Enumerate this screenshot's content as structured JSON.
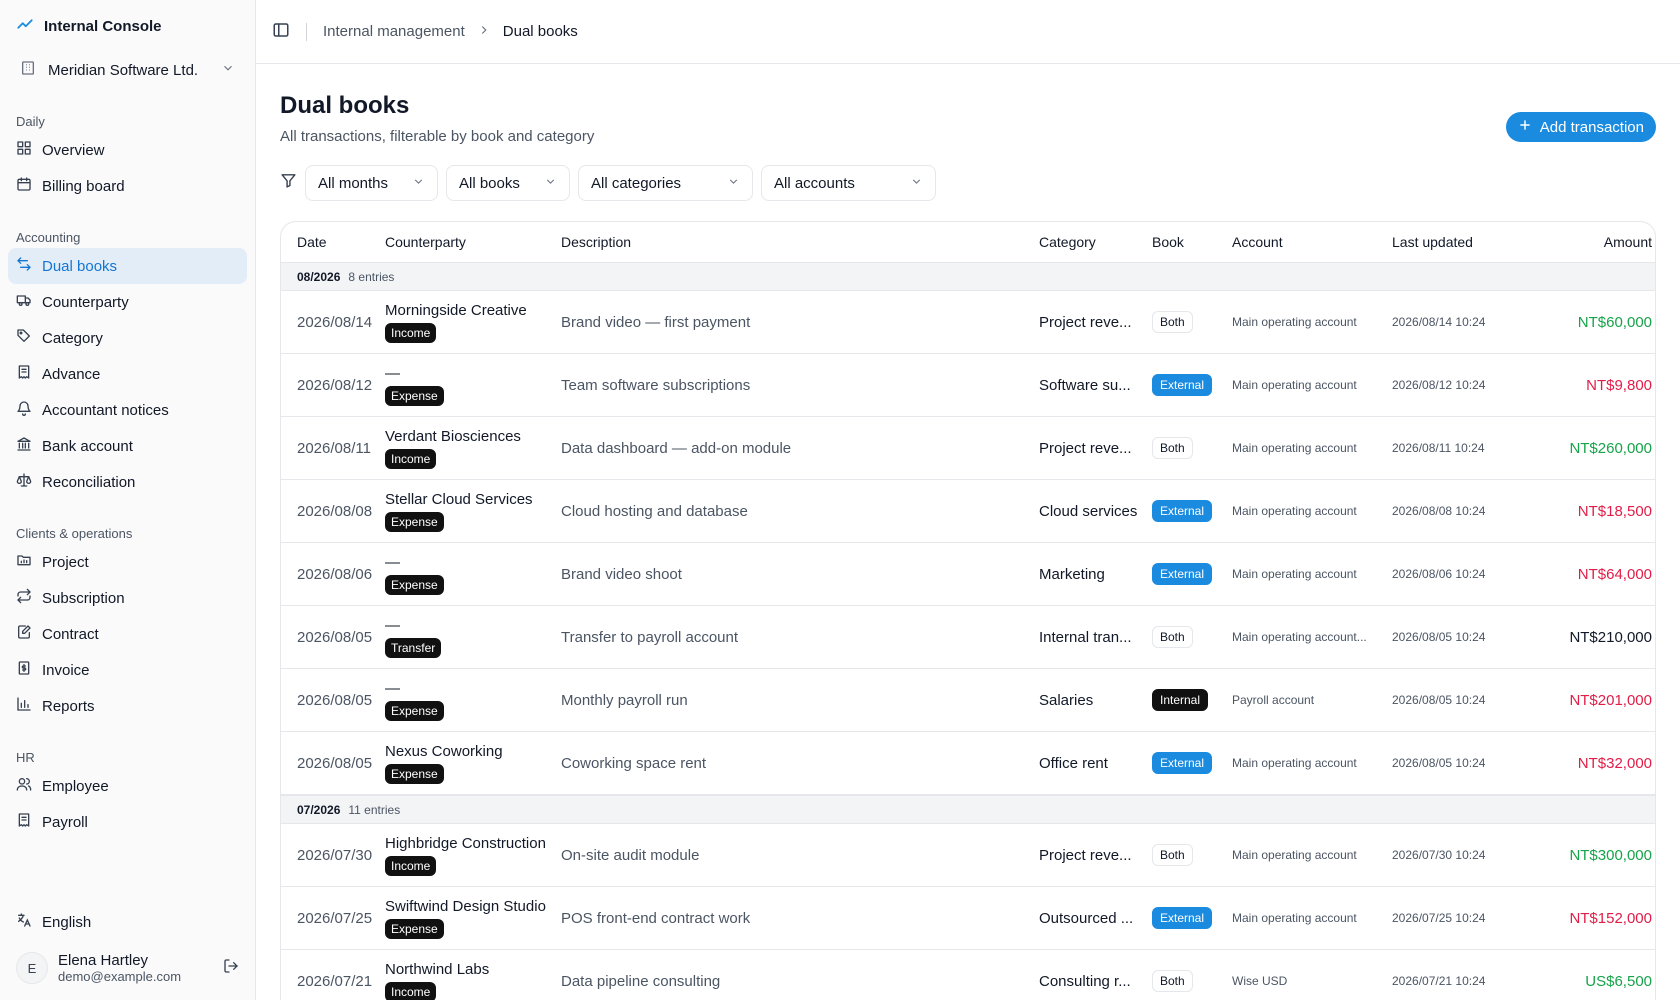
{
  "app": {
    "title": "Internal Console",
    "org": "Meridian Software Ltd."
  },
  "sidebar": {
    "sections": [
      {
        "heading": "Daily",
        "items": [
          {
            "label": "Overview",
            "icon": "grid-icon"
          },
          {
            "label": "Billing board",
            "icon": "calendar-icon"
          }
        ]
      },
      {
        "heading": "Accounting",
        "items": [
          {
            "label": "Dual books",
            "icon": "swap-icon",
            "active": true
          },
          {
            "label": "Counterparty",
            "icon": "truck-icon"
          },
          {
            "label": "Category",
            "icon": "tag-icon"
          },
          {
            "label": "Advance",
            "icon": "receipt-icon"
          },
          {
            "label": "Accountant notices",
            "icon": "bell-icon"
          },
          {
            "label": "Bank account",
            "icon": "bank-icon"
          },
          {
            "label": "Reconciliation",
            "icon": "scale-icon"
          }
        ]
      },
      {
        "heading": "Clients & operations",
        "items": [
          {
            "label": "Project",
            "icon": "folder-icon"
          },
          {
            "label": "Subscription",
            "icon": "repeat-icon"
          },
          {
            "label": "Contract",
            "icon": "edit-doc-icon"
          },
          {
            "label": "Invoice",
            "icon": "invoice-icon"
          },
          {
            "label": "Reports",
            "icon": "bar-chart-icon"
          }
        ]
      },
      {
        "heading": "HR",
        "items": [
          {
            "label": "Employee",
            "icon": "users-icon"
          },
          {
            "label": "Payroll",
            "icon": "receipt-icon"
          }
        ]
      }
    ],
    "language": "English",
    "user": {
      "initial": "E",
      "name": "Elena Hartley",
      "email": "demo@example.com"
    }
  },
  "breadcrumb": {
    "parent": "Internal management",
    "current": "Dual books"
  },
  "page": {
    "title": "Dual books",
    "subtitle": "All transactions, filterable by book and category",
    "add_label": "Add transaction"
  },
  "filters": [
    "All months",
    "All books",
    "All categories",
    "All accounts"
  ],
  "table": {
    "columns": [
      "Date",
      "Counterparty",
      "Description",
      "Category",
      "Book",
      "Account",
      "Last updated",
      "Amount"
    ],
    "groups": [
      {
        "month": "08/2026",
        "count": "8 entries",
        "rows": [
          {
            "date": "2026/08/14",
            "counterparty": "Morningside Creative",
            "type": "Income",
            "description": "Brand video — first payment",
            "category": "Project reve...",
            "book": "Both",
            "account": "Main operating account",
            "updated": "2026/08/14 10:24",
            "amount": "NT$60,000"
          },
          {
            "date": "2026/08/12",
            "counterparty": "—",
            "type": "Expense",
            "description": "Team software subscriptions",
            "category": "Software su...",
            "book": "External",
            "account": "Main operating account",
            "updated": "2026/08/12 10:24",
            "amount": "NT$9,800"
          },
          {
            "date": "2026/08/11",
            "counterparty": "Verdant Biosciences",
            "type": "Income",
            "description": "Data dashboard — add-on module",
            "category": "Project reve...",
            "book": "Both",
            "account": "Main operating account",
            "updated": "2026/08/11 10:24",
            "amount": "NT$260,000"
          },
          {
            "date": "2026/08/08",
            "counterparty": "Stellar Cloud Services",
            "type": "Expense",
            "description": "Cloud hosting and database",
            "category": "Cloud services",
            "book": "External",
            "account": "Main operating account",
            "updated": "2026/08/08 10:24",
            "amount": "NT$18,500"
          },
          {
            "date": "2026/08/06",
            "counterparty": "—",
            "type": "Expense",
            "description": "Brand video shoot",
            "category": "Marketing",
            "book": "External",
            "account": "Main operating account",
            "updated": "2026/08/06 10:24",
            "amount": "NT$64,000"
          },
          {
            "date": "2026/08/05",
            "counterparty": "—",
            "type": "Transfer",
            "description": "Transfer to payroll account",
            "category": "Internal tran...",
            "book": "Both",
            "account": "Main operating account...",
            "updated": "2026/08/05 10:24",
            "amount": "NT$210,000"
          },
          {
            "date": "2026/08/05",
            "counterparty": "—",
            "type": "Expense",
            "description": "Monthly payroll run",
            "category": "Salaries",
            "book": "Internal",
            "account": "Payroll account",
            "updated": "2026/08/05 10:24",
            "amount": "NT$201,000"
          },
          {
            "date": "2026/08/05",
            "counterparty": "Nexus Coworking",
            "type": "Expense",
            "description": "Coworking space rent",
            "category": "Office rent",
            "book": "External",
            "account": "Main operating account",
            "updated": "2026/08/05 10:24",
            "amount": "NT$32,000"
          }
        ]
      },
      {
        "month": "07/2026",
        "count": "11 entries",
        "rows": [
          {
            "date": "2026/07/30",
            "counterparty": "Highbridge Construction",
            "type": "Income",
            "description": "On-site audit module",
            "category": "Project reve...",
            "book": "Both",
            "account": "Main operating account",
            "updated": "2026/07/30 10:24",
            "amount": "NT$300,000"
          },
          {
            "date": "2026/07/25",
            "counterparty": "Swiftwind Design Studio",
            "type": "Expense",
            "description": "POS front-end contract work",
            "category": "Outsourced ...",
            "book": "External",
            "account": "Main operating account",
            "updated": "2026/07/25 10:24",
            "amount": "NT$152,000"
          },
          {
            "date": "2026/07/21",
            "counterparty": "Northwind Labs",
            "type": "Income",
            "description": "Data pipeline consulting",
            "category": "Consulting r...",
            "book": "Both",
            "account": "Wise USD",
            "updated": "2026/07/21 10:24",
            "amount": "US$6,500"
          }
        ]
      }
    ]
  }
}
